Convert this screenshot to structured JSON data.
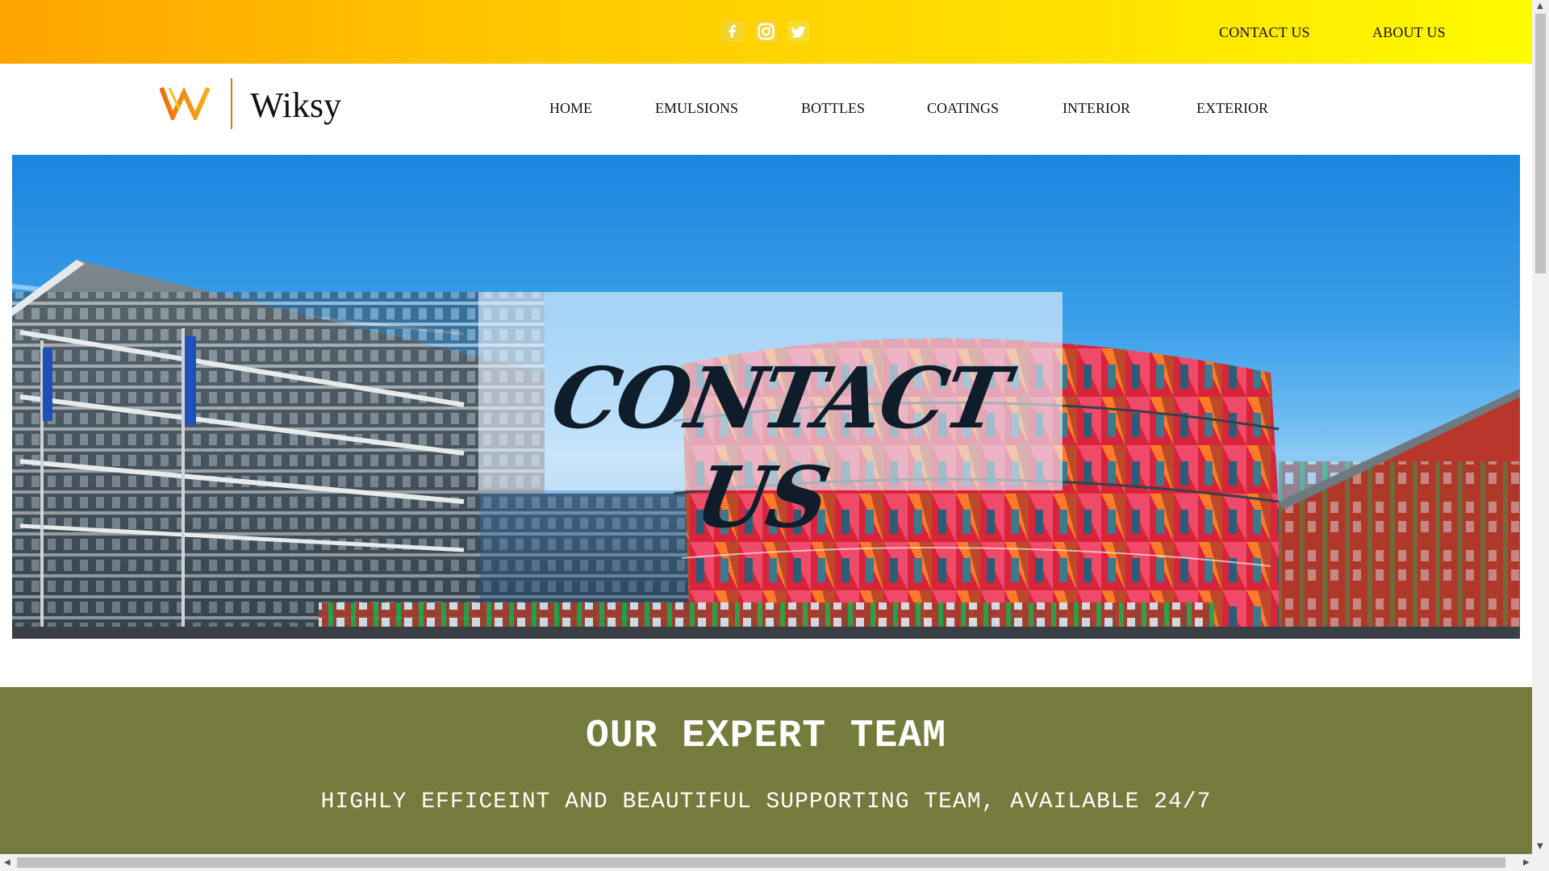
{
  "topbar": {
    "social_icons": [
      "facebook-icon",
      "instagram-icon",
      "twitter-icon"
    ],
    "links": [
      "CONTACT US",
      "ABOUT US"
    ]
  },
  "header": {
    "brand": "Wiksy",
    "nav": [
      "HOME",
      "EMULSIONS",
      "BOTTLES",
      "COATINGS",
      "INTERIOR",
      "EXTERIOR"
    ]
  },
  "hero": {
    "title": "CONTACT US"
  },
  "team": {
    "title": "OUR EXPERT TEAM",
    "subtitle": "HIGHLY EFFICEINT AND BEAUTIFUL SUPPORTING TEAM, AVAILABLE 24/7"
  },
  "colors": {
    "topbar_start": "#ffa400",
    "topbar_end": "#fffb00",
    "logo_accent": "#e07a10",
    "team_bg": "#757b3d"
  }
}
